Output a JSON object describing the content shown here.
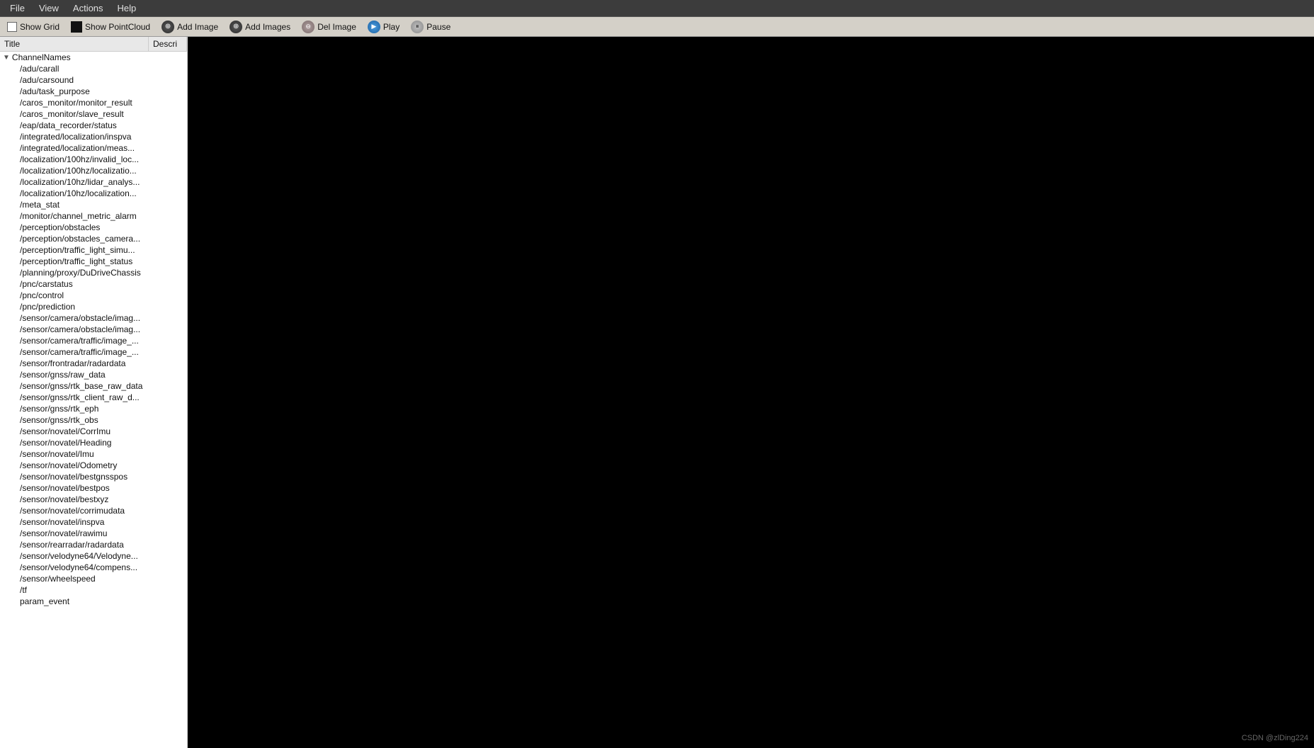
{
  "menubar": {
    "items": [
      "File",
      "View",
      "Actions",
      "Help"
    ]
  },
  "toolbar": {
    "show_grid_label": "Show Grid",
    "show_pointcloud_label": "Show PointCloud",
    "add_image_label": "Add Image",
    "add_images_label": "Add Images",
    "del_image_label": "Del Image",
    "play_label": "Play",
    "pause_label": "Pause"
  },
  "tree": {
    "title_col": "Title",
    "desc_col": "Descri",
    "root_label": "ChannelNames",
    "items": [
      "/adu/carall",
      "/adu/carsound",
      "/adu/task_purpose",
      "/caros_monitor/monitor_result",
      "/caros_monitor/slave_result",
      "/eap/data_recorder/status",
      "/integrated/localization/inspva",
      "/integrated/localization/meas...",
      "/localization/100hz/invalid_loc...",
      "/localization/100hz/localizatio...",
      "/localization/10hz/lidar_analys...",
      "/localization/10hz/localization...",
      "/meta_stat",
      "/monitor/channel_metric_alarm",
      "/perception/obstacles",
      "/perception/obstacles_camera...",
      "/perception/traffic_light_simu...",
      "/perception/traffic_light_status",
      "/planning/proxy/DuDriveChassis",
      "/pnc/carstatus",
      "/pnc/control",
      "/pnc/prediction",
      "/sensor/camera/obstacle/imag...",
      "/sensor/camera/obstacle/imag...",
      "/sensor/camera/traffic/image_...",
      "/sensor/camera/traffic/image_...",
      "/sensor/frontradar/radardata",
      "/sensor/gnss/raw_data",
      "/sensor/gnss/rtk_base_raw_data",
      "/sensor/gnss/rtk_client_raw_d...",
      "/sensor/gnss/rtk_eph",
      "/sensor/gnss/rtk_obs",
      "/sensor/novatel/CorrImu",
      "/sensor/novatel/Heading",
      "/sensor/novatel/Imu",
      "/sensor/novatel/Odometry",
      "/sensor/novatel/bestgnsspos",
      "/sensor/novatel/bestpos",
      "/sensor/novatel/bestxyz",
      "/sensor/novatel/corrimudata",
      "/sensor/novatel/inspva",
      "/sensor/novatel/rawimu",
      "/sensor/rearradar/radardata",
      "/sensor/velodyne64/Velodyne...",
      "/sensor/velodyne64/compens...",
      "/sensor/wheelspeed",
      "/tf",
      "param_event"
    ]
  },
  "watermark": "CSDN @zlDing224"
}
